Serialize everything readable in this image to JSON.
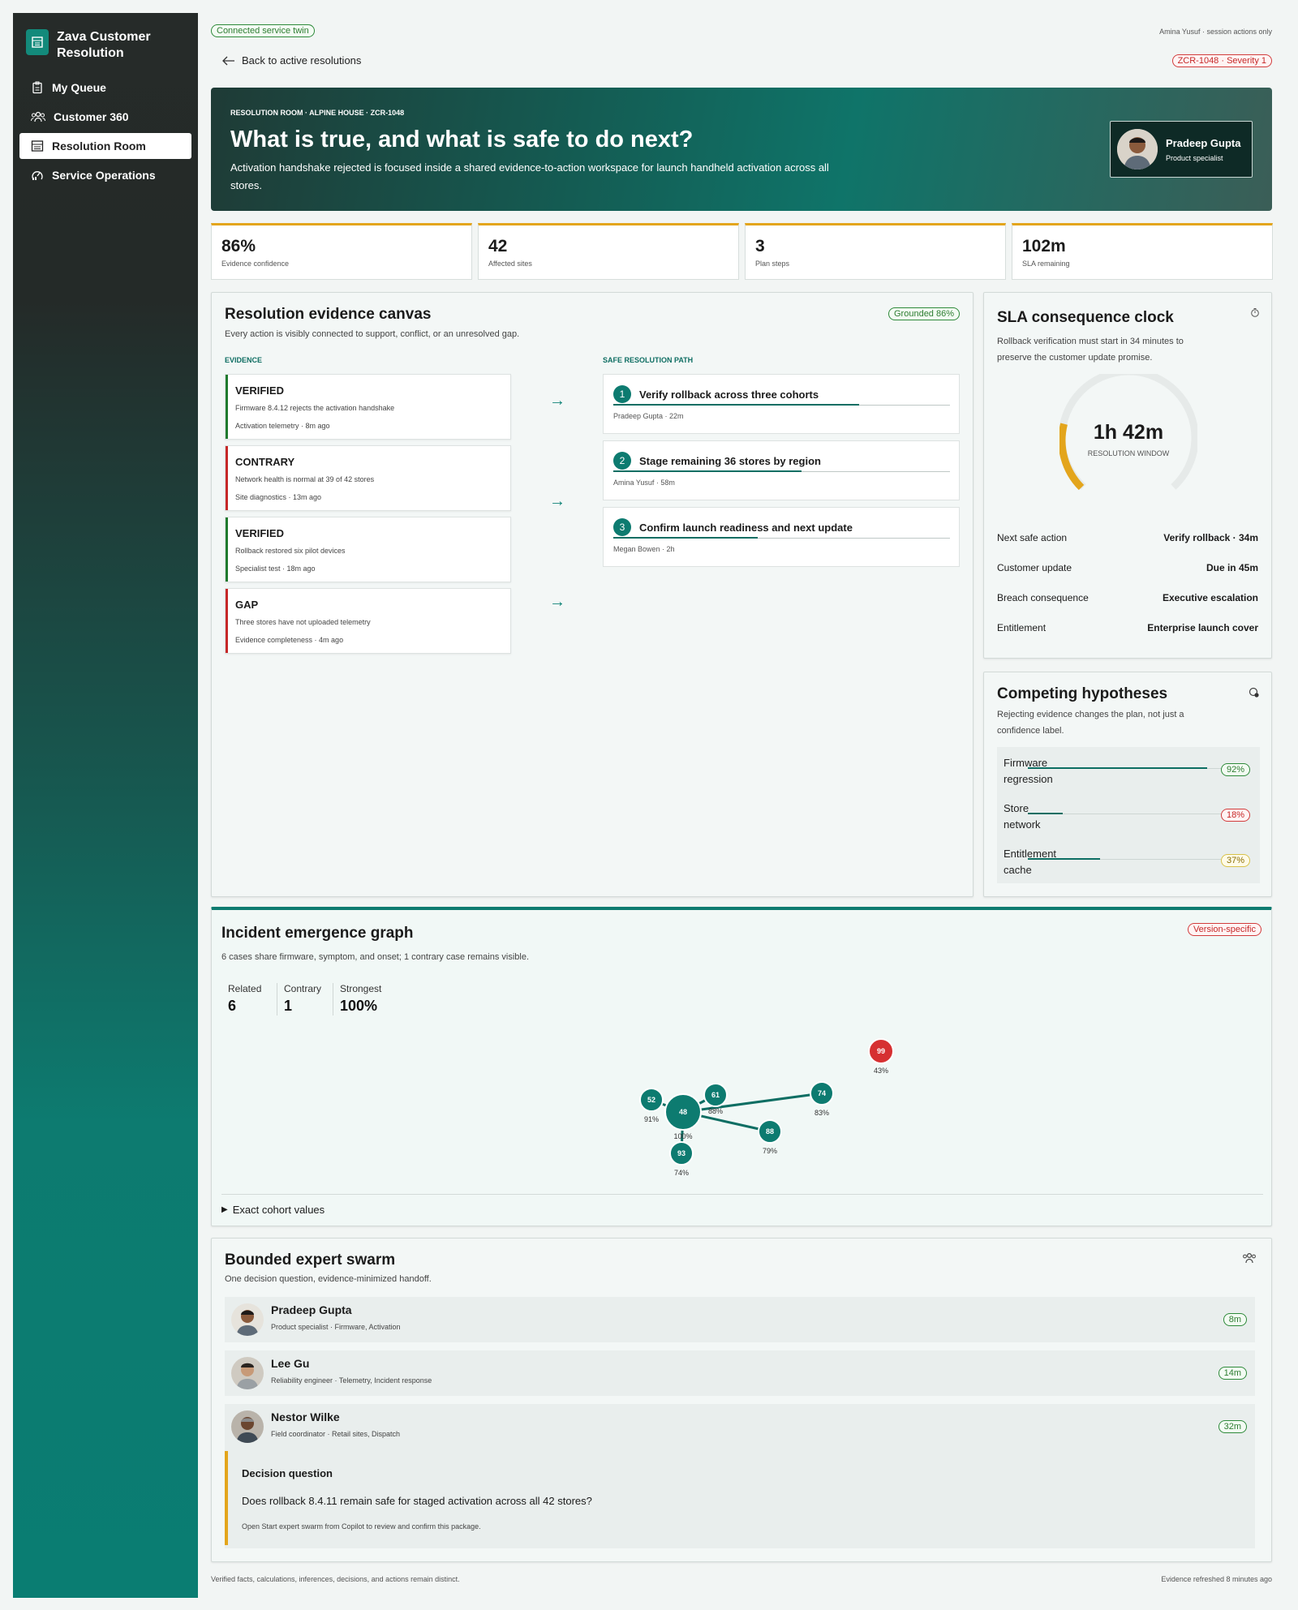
{
  "app": {
    "name": "Zava Customer Resolution"
  },
  "nav": {
    "items": [
      {
        "label": "My Queue",
        "icon": "clipboard-icon"
      },
      {
        "label": "Customer 360",
        "icon": "people-icon"
      },
      {
        "label": "Resolution Room",
        "icon": "building-icon",
        "active": true
      },
      {
        "label": "Service Operations",
        "icon": "chart-gauge-icon"
      }
    ]
  },
  "top": {
    "twin_pill": "Connected service twin",
    "session_note": "Amina Yusuf · session actions only",
    "back_link": "Back to active resolutions",
    "severity_pill": "ZCR-1048 · Severity 1"
  },
  "hero": {
    "kicker": "RESOLUTION ROOM · ALPINE HOUSE · ZCR-1048",
    "title": "What is true, and what is safe to do next?",
    "description": "Activation handshake rejected is focused inside a shared evidence-to-action workspace for launch handheld activation across all stores.",
    "person": {
      "name": "Pradeep Gupta",
      "role": "Product specialist"
    }
  },
  "kpis": [
    {
      "value": "86%",
      "label": "Evidence confidence"
    },
    {
      "value": "42",
      "label": "Affected sites"
    },
    {
      "value": "3",
      "label": "Plan steps"
    },
    {
      "value": "102m",
      "label": "SLA remaining"
    }
  ],
  "canvas": {
    "title": "Resolution evidence canvas",
    "badge": "Grounded 86%",
    "subtitle": "Every action is visibly connected to support, conflict, or an unresolved gap.",
    "evidence_label": "EVIDENCE",
    "path_label": "SAFE RESOLUTION PATH",
    "evidence": [
      {
        "kind": "VERIFIED",
        "text": "Firmware 8.4.12 rejects the activation handshake",
        "meta": "Activation telemetry · 8m ago",
        "color": "#1f7a2e"
      },
      {
        "kind": "CONTRARY",
        "text": "Network health is normal at 39 of 42 stores",
        "meta": "Site diagnostics · 13m ago",
        "color": "#c62828"
      },
      {
        "kind": "VERIFIED",
        "text": "Rollback restored six pilot devices",
        "meta": "Specialist test · 18m ago",
        "color": "#1f7a2e"
      },
      {
        "kind": "GAP",
        "text": "Three stores have not uploaded telemetry",
        "meta": "Evidence completeness · 4m ago",
        "color": "#c62828"
      }
    ],
    "steps": [
      {
        "num": "1",
        "title": "Verify rollback across three cohorts",
        "meta": "Pradeep Gupta · 22m",
        "progress": 0.73
      },
      {
        "num": "2",
        "title": "Stage remaining 36 stores by region",
        "meta": "Amina Yusuf · 58m",
        "progress": 0.56
      },
      {
        "num": "3",
        "title": "Confirm launch readiness and next update",
        "meta": "Megan Bowen · 2h",
        "progress": 0.43
      }
    ]
  },
  "sla": {
    "title": "SLA consequence clock",
    "subtitle": "Rollback verification must start in 34 minutes to preserve the customer update promise.",
    "clock_value": "1h 42m",
    "clock_label": "RESOLUTION WINDOW",
    "clock_fraction": 0.22,
    "rows": [
      {
        "label": "Next safe action",
        "value": "Verify rollback · 34m"
      },
      {
        "label": "Customer update",
        "value": "Due in 45m"
      },
      {
        "label": "Breach consequence",
        "value": "Executive escalation"
      },
      {
        "label": "Entitlement",
        "value": "Enterprise launch cover"
      }
    ]
  },
  "hypotheses": {
    "title": "Competing hypotheses",
    "subtitle": "Rejecting evidence changes the plan, not just a confidence label.",
    "items": [
      {
        "line1": "Firmware",
        "line2": "regression",
        "pct": "92%",
        "value": 0.92,
        "tone": "green"
      },
      {
        "line1": "Store",
        "line2": "network",
        "pct": "18%",
        "value": 0.18,
        "tone": "red"
      },
      {
        "line1": "Entitlement",
        "line2": "cache",
        "pct": "37%",
        "value": 0.37,
        "tone": "yellow"
      }
    ]
  },
  "graph": {
    "title": "Incident emergence graph",
    "badge": "Version-specific",
    "subtitle": "6 cases share firmware, symptom, and onset; 1 contrary case remains visible.",
    "stats": [
      {
        "label": "Related",
        "value": "6"
      },
      {
        "label": "Contrary",
        "value": "1"
      },
      {
        "label": "Strongest",
        "value": "100%"
      }
    ],
    "nodes": [
      {
        "id": "48",
        "pct": "100%",
        "center": true
      },
      {
        "id": "52",
        "pct": "91%"
      },
      {
        "id": "61",
        "pct": "88%"
      },
      {
        "id": "74",
        "pct": "83%"
      },
      {
        "id": "88",
        "pct": "79%"
      },
      {
        "id": "93",
        "pct": "74%"
      },
      {
        "id": "99",
        "pct": "43%",
        "contrary": true
      }
    ],
    "details_label": "Exact cohort values"
  },
  "swarm": {
    "title": "Bounded expert swarm",
    "subtitle": "One decision question, evidence-minimized handoff.",
    "experts": [
      {
        "name": "Pradeep Gupta",
        "role": "Product specialist · Firmware, Activation",
        "time": "8m"
      },
      {
        "name": "Lee Gu",
        "role": "Reliability engineer · Telemetry, Incident response",
        "time": "14m"
      },
      {
        "name": "Nestor Wilke",
        "role": "Field coordinator · Retail sites, Dispatch",
        "time": "32m"
      }
    ],
    "decision": {
      "label": "Decision question",
      "question": "Does rollback 8.4.11 remain safe for staged activation across all 42 stores?",
      "hint": "Open Start expert swarm from Copilot to review and confirm this package."
    }
  },
  "footer": {
    "left": "Verified facts, calculations, inferences, decisions, and actions remain distinct.",
    "right": "Evidence refreshed 8 minutes ago"
  },
  "colors": {
    "accent": "#0d7b70",
    "kpi_top": "#e3a51c",
    "verified": "#1f7a2e",
    "contrary": "#c62828",
    "clock": "#e3a51c"
  }
}
